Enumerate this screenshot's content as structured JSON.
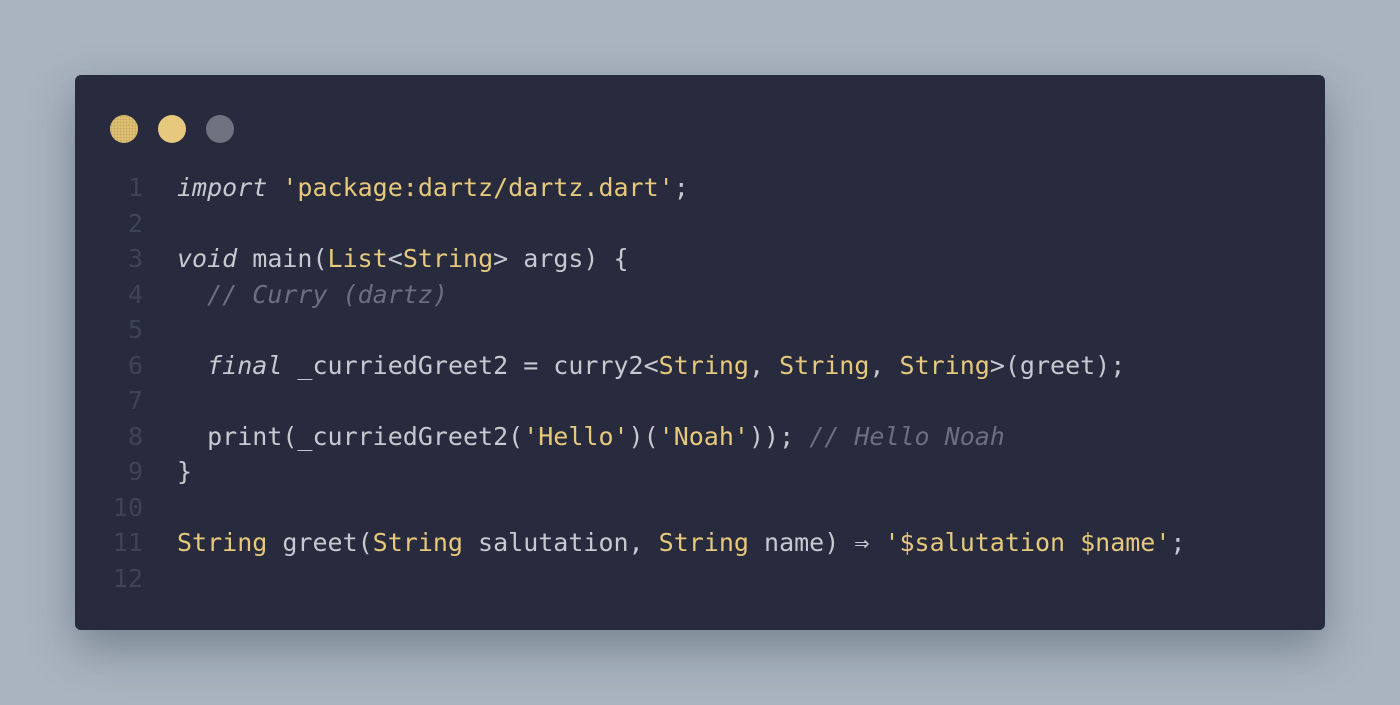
{
  "window": {
    "controls": [
      "window-dot-1",
      "window-dot-2",
      "window-dot-3"
    ]
  },
  "code": {
    "lines": [
      {
        "n": "1",
        "tokens": [
          {
            "t": "import",
            "c": "kw"
          },
          {
            "t": " ",
            "c": "pl"
          },
          {
            "t": "'package:dartz/dartz.dart'",
            "c": "str"
          },
          {
            "t": ";",
            "c": "pl"
          }
        ]
      },
      {
        "n": "2",
        "tokens": []
      },
      {
        "n": "3",
        "tokens": [
          {
            "t": "void",
            "c": "kw"
          },
          {
            "t": " main(",
            "c": "pl"
          },
          {
            "t": "List",
            "c": "ty"
          },
          {
            "t": "<",
            "c": "pl"
          },
          {
            "t": "String",
            "c": "ty"
          },
          {
            "t": "> args) {",
            "c": "pl"
          }
        ]
      },
      {
        "n": "4",
        "tokens": [
          {
            "t": "  ",
            "c": "pl"
          },
          {
            "t": "// Curry (dartz)",
            "c": "cm"
          }
        ]
      },
      {
        "n": "5",
        "tokens": []
      },
      {
        "n": "6",
        "tokens": [
          {
            "t": "  ",
            "c": "pl"
          },
          {
            "t": "final",
            "c": "kw"
          },
          {
            "t": " _curriedGreet2 = curry2<",
            "c": "pl"
          },
          {
            "t": "String",
            "c": "ty"
          },
          {
            "t": ", ",
            "c": "pl"
          },
          {
            "t": "String",
            "c": "ty"
          },
          {
            "t": ", ",
            "c": "pl"
          },
          {
            "t": "String",
            "c": "ty"
          },
          {
            "t": ">(greet);",
            "c": "pl"
          }
        ]
      },
      {
        "n": "7",
        "tokens": []
      },
      {
        "n": "8",
        "tokens": [
          {
            "t": "  print(_curriedGreet2(",
            "c": "pl"
          },
          {
            "t": "'Hello'",
            "c": "str"
          },
          {
            "t": ")(",
            "c": "pl"
          },
          {
            "t": "'Noah'",
            "c": "str"
          },
          {
            "t": ")); ",
            "c": "pl"
          },
          {
            "t": "// Hello Noah",
            "c": "cm"
          }
        ]
      },
      {
        "n": "9",
        "tokens": [
          {
            "t": "}",
            "c": "pl"
          }
        ]
      },
      {
        "n": "10",
        "tokens": []
      },
      {
        "n": "11",
        "tokens": [
          {
            "t": "String",
            "c": "ty"
          },
          {
            "t": " greet(",
            "c": "pl"
          },
          {
            "t": "String",
            "c": "ty"
          },
          {
            "t": " salutation, ",
            "c": "pl"
          },
          {
            "t": "String",
            "c": "ty"
          },
          {
            "t": " name) ⇒ ",
            "c": "pl"
          },
          {
            "t": "'$salutation $name'",
            "c": "str"
          },
          {
            "t": ";",
            "c": "pl"
          }
        ]
      },
      {
        "n": "12",
        "tokens": []
      }
    ]
  }
}
